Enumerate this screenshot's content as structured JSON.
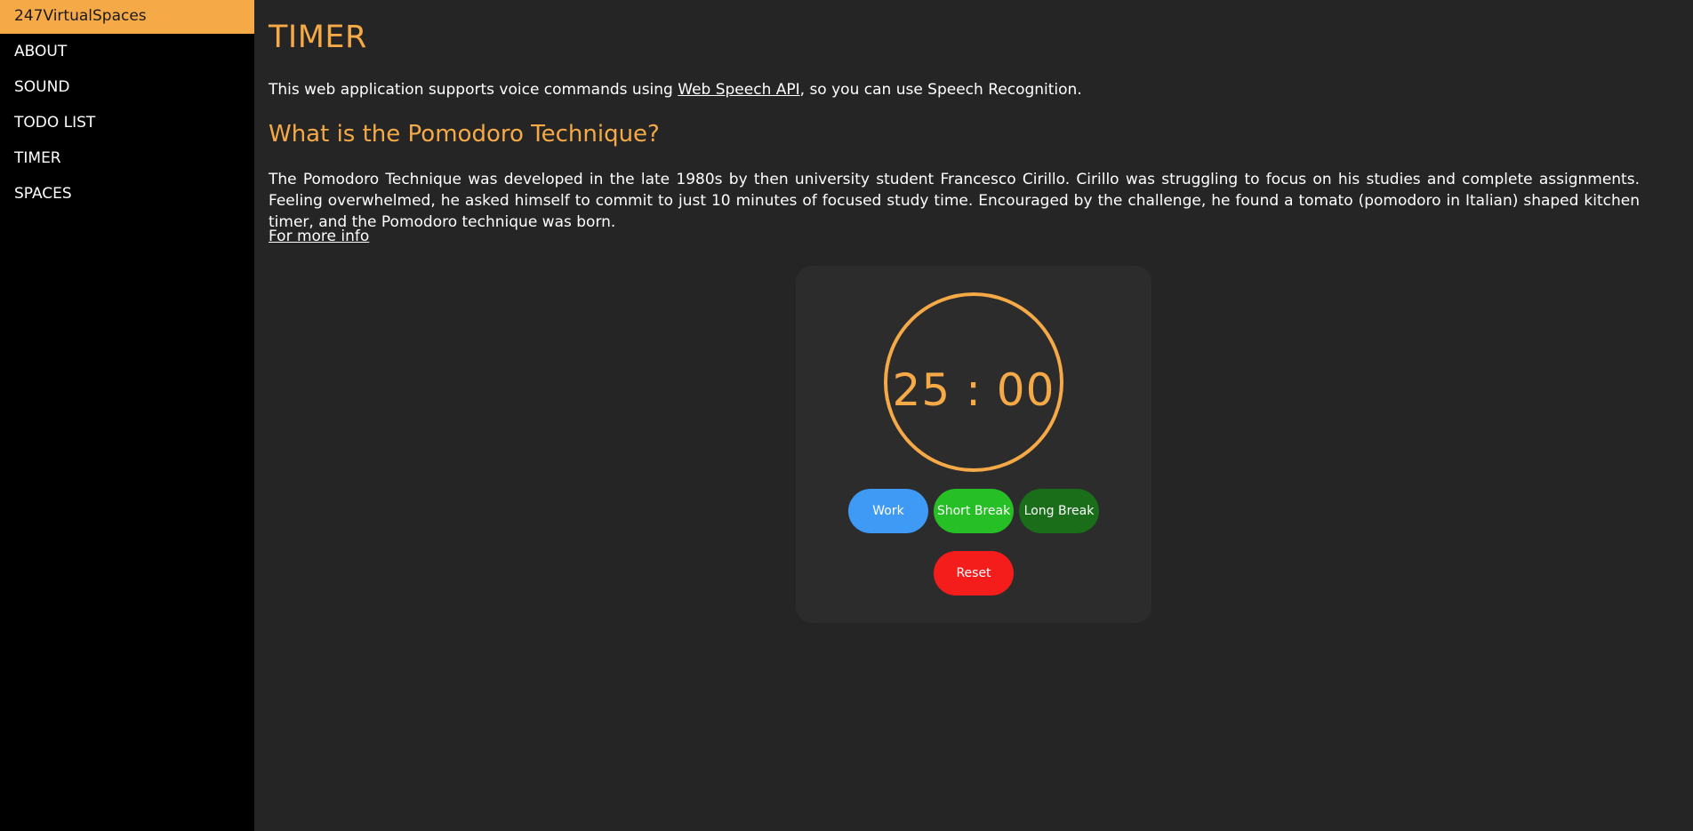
{
  "sidebar": {
    "items": [
      {
        "label": "247VirtualSpaces",
        "active": true
      },
      {
        "label": "ABOUT"
      },
      {
        "label": "SOUND"
      },
      {
        "label": "TODO LIST"
      },
      {
        "label": "TIMER"
      },
      {
        "label": "SPACES"
      }
    ]
  },
  "main": {
    "title": "TIMER",
    "intro_before": "This web application supports voice commands using ",
    "intro_link": "Web Speech API",
    "intro_after": ", so you can use Speech Recognition.",
    "section_heading": "What is the Pomodoro Technique?",
    "description": "The Pomodoro Technique was developed in the late 1980s by then university student Francesco Cirillo. Cirillo was struggling to focus on his studies and complete assignments. Feeling overwhelmed, he asked himself to commit to just 10 minutes of focused study time. Encouraged by the challenge, he found a tomato (pomodoro in Italian) shaped kitchen timer, and the Pomodoro technique was born.",
    "more_link": "For more info"
  },
  "timer": {
    "display": "25 : 00",
    "buttons": {
      "work": "Work",
      "short_break": "Short Break",
      "long_break": "Long Break",
      "reset": "Reset"
    }
  },
  "colors": {
    "accent": "#f5a947",
    "work": "#3f9af5",
    "short_break": "#26bf26",
    "long_break": "#1a6e1a",
    "reset": "#f51c1c"
  }
}
